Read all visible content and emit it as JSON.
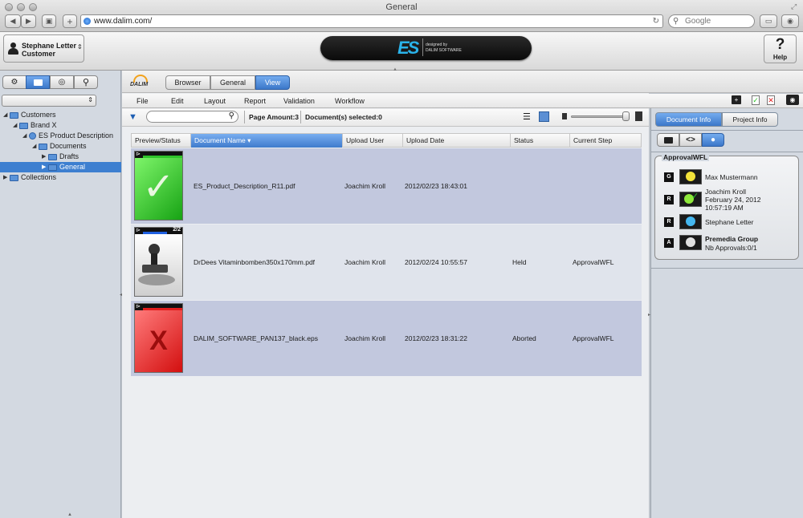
{
  "browser": {
    "title": "General",
    "url": "www.dalim.com/",
    "search_placeholder": "Google"
  },
  "user": {
    "name": "Stephane Letter",
    "role": "Customer"
  },
  "help_label": "Help",
  "logo": {
    "es": "ES",
    "designed_by": "designed by",
    "company": "DALIM SOFTWARE"
  },
  "tree": [
    {
      "label": "Customers",
      "depth": 0
    },
    {
      "label": "Brand X",
      "depth": 1
    },
    {
      "label": "ES Product Description",
      "depth": 2
    },
    {
      "label": "Documents",
      "depth": 3
    },
    {
      "label": "Drafts",
      "depth": 4
    },
    {
      "label": "General",
      "depth": 4
    },
    {
      "label": "Collections",
      "depth": 0
    }
  ],
  "modes": [
    "Browser",
    "General",
    "View"
  ],
  "menus": [
    "File",
    "Edit",
    "Layout",
    "Report",
    "Validation",
    "Workflow"
  ],
  "toolbar": {
    "page_amount": "Page Amount:3",
    "selected": "Document(s) selected:0"
  },
  "columns": [
    "Preview/Status",
    "Document Name",
    "Upload User",
    "Upload Date",
    "Status",
    "Current Step"
  ],
  "rows": [
    {
      "name": "ES_Product_Description_R11.pdf",
      "user": "Joachim Kroll",
      "date": "2012/02/23 18:43:01",
      "status": "",
      "step": "",
      "badge": ""
    },
    {
      "name": "DrDees Vitaminbomben350x170mm.pdf",
      "user": "Joachim Kroll",
      "date": "2012/02/24 10:55:57",
      "status": "Held",
      "step": "ApprovalWFL",
      "badge": "2/2"
    },
    {
      "name": "DALIM_SOFTWARE_PAN137_black.eps",
      "user": "Joachim Kroll",
      "date": "2012/02/23 18:31:22",
      "status": "Aborted",
      "step": "ApprovalWFL",
      "badge": ""
    }
  ],
  "right": {
    "tab_doc": "Document Info",
    "tab_proj": "Project Info",
    "workflow_title": "ApprovalWFL",
    "steps": [
      {
        "letter": "G",
        "l1": "Max Mustermann",
        "l2": "",
        "l3": ""
      },
      {
        "letter": "R",
        "l1": "Joachim Kroll",
        "l2": "February 24, 2012",
        "l3": "10:57:19 AM"
      },
      {
        "letter": "R",
        "l1": "Stephane Letter",
        "l2": "",
        "l3": ""
      },
      {
        "letter": "A",
        "l1": "Premedia Group",
        "l2": "Nb Approvals:0/1",
        "l3": ""
      }
    ]
  },
  "colors": {
    "accent": "#3d7fd0",
    "row_even": "#c2c8de",
    "row_odd": "#e0e4ec",
    "approved": "#2fc42a",
    "rejected": "#e21d1d"
  }
}
